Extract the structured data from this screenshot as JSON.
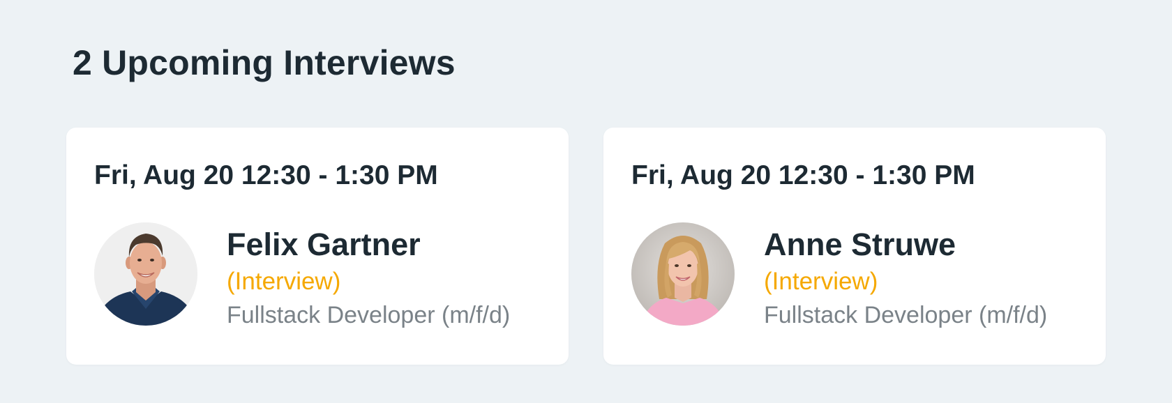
{
  "page": {
    "title": "2 Upcoming Interviews"
  },
  "interviews": [
    {
      "time": "Fri, Aug 20 12:30 - 1:30 PM",
      "name": "Felix Gartner",
      "stage": "(Interview)",
      "role": "Fullstack Developer (m/f/d)"
    },
    {
      "time": "Fri, Aug 20 12:30 - 1:30 PM",
      "name": "Anne Struwe",
      "stage": "(Interview)",
      "role": "Fullstack Developer (m/f/d)"
    }
  ],
  "colors": {
    "background": "#edf2f5",
    "card": "#ffffff",
    "text_primary": "#1d2a33",
    "stage_accent": "#f5a800",
    "text_secondary": "#7a8288"
  }
}
